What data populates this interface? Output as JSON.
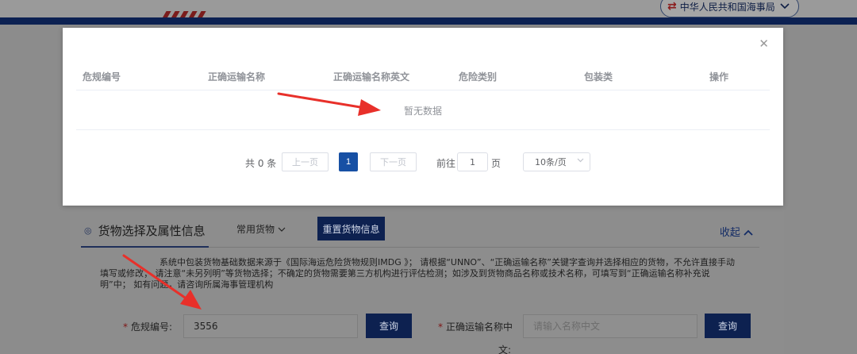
{
  "header": {
    "org_name": "中华人民共和国海事局",
    "swap_icon": "swap-arrows-icon",
    "chevron_icon": "chevron-down-icon"
  },
  "modal": {
    "columns": [
      "危规编号",
      "正确运输名称",
      "正确运输名称英文",
      "危险类别",
      "包装类",
      "操作"
    ],
    "empty_text": "暂无数据",
    "close_icon": "close-icon",
    "pagination": {
      "total_text": "共 0 条",
      "prev_label": "上一页",
      "current_page": "1",
      "next_label": "下一页",
      "goto_label": "前往",
      "goto_value": "1",
      "page_suffix": "页",
      "page_size": "10条/页"
    }
  },
  "section": {
    "tab_label": "货物选择及属性信息",
    "common_goods": "常用货物",
    "reset_label": "重置货物信息",
    "collapse_label": "收起",
    "notice": "系统中包装货物基础数据来源于《国际海运危险货物规则IMDG 》； 请根据“UNNO”、“正确运输名称”关键字查询并选择相应的货物，不允许直接手动填写或修改； 请注意“未另列明”等货物选择；不确定的货物需要第三方机构进行评估检测；如涉及到货物商品名称或技术名称，可填写到“正确运输名称补充说明”中； 如有问题，请咨询所属海事管理机构"
  },
  "form": {
    "un_label": "危规编号:",
    "un_value": "3556",
    "query_label": "查询",
    "name_label_line1": "正确运输名称中",
    "name_label_line2": "文:",
    "name_placeholder": "请输入名称中文"
  },
  "colors": {
    "navy": "#0d2150",
    "page_blue": "#1750a4",
    "arrow_red": "#e8302a",
    "required_star": "#7d1414"
  }
}
